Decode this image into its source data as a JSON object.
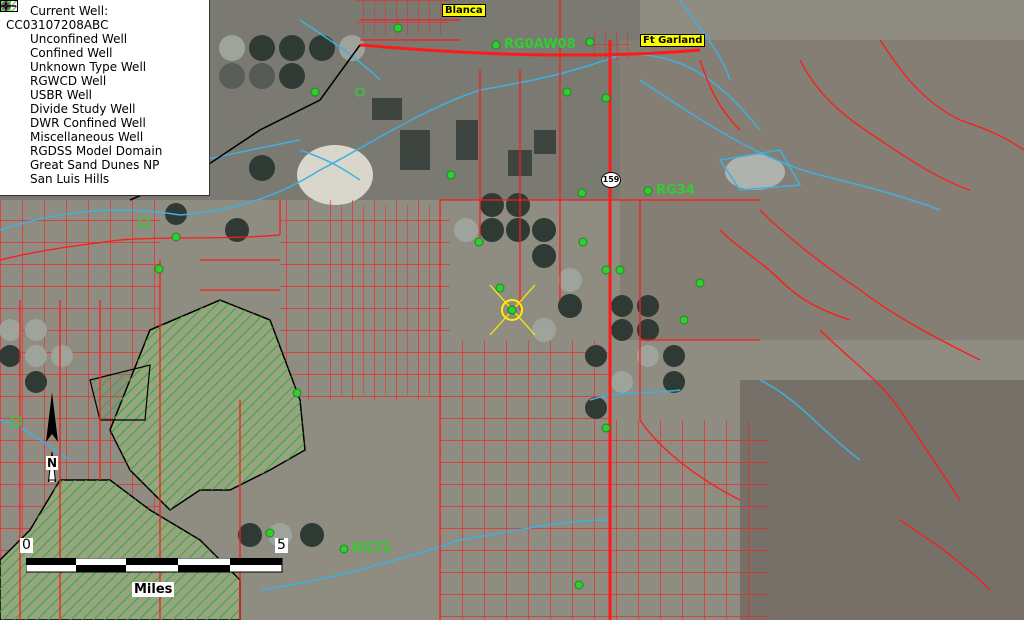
{
  "legend": {
    "current_well_label": "Current Well:",
    "current_well_id": "CC03107208ABC",
    "items": [
      {
        "label": "Unconfined Well",
        "icon": "unconfined-well-icon",
        "color": "#33cc33"
      },
      {
        "label": "Confined Well",
        "icon": "confined-well-icon",
        "color": "#33cc33"
      },
      {
        "label": "Unknown Type Well",
        "icon": "unknown-well-icon",
        "color": "#33cc33"
      },
      {
        "label": "RGWCD Well",
        "icon": "rgwcd-well-icon",
        "color": "#ffee00"
      },
      {
        "label": "USBR Well",
        "icon": "usbr-well-icon",
        "color": "#1e90ff"
      },
      {
        "label": "Divide Study Well",
        "icon": "divide-study-well-icon",
        "color": "#8800cc"
      },
      {
        "label": "DWR Confined Well",
        "icon": "dwr-confined-well-icon",
        "color": "#ff00ff"
      },
      {
        "label": "Miscellaneous Well",
        "icon": "misc-well-icon",
        "color": "#000000"
      },
      {
        "label": "RGDSS Model Domain",
        "icon": "model-domain-line-icon",
        "color": "#000000"
      },
      {
        "label": "Great Sand Dunes NP",
        "icon": "dunes-hatch-icon",
        "color": "#000000"
      },
      {
        "label": "San Luis Hills",
        "icon": "san-luis-hills-hatch-icon",
        "color": "#33aa33"
      }
    ]
  },
  "places": {
    "blanca": "Blanca",
    "ft_garland": "Ft Garland"
  },
  "well_labels": {
    "top": "RG0AW08",
    "rg34": "RG34",
    "rg72": "RG72"
  },
  "highway": "159",
  "scale": {
    "start": "0",
    "end": "5",
    "units": "Miles"
  },
  "north": "N",
  "colors": {
    "roads": "#ff1a1a",
    "streams": "#3fb0e0",
    "wells": "#33cc33",
    "current_well": "#ffee00",
    "hills_hatch": "#33aa33"
  }
}
